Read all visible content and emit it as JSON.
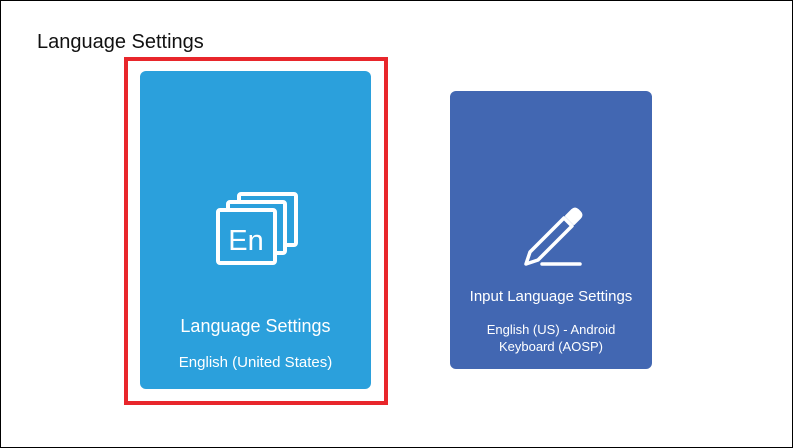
{
  "page": {
    "title": "Language Settings"
  },
  "cards": {
    "language": {
      "label": "Language Settings",
      "value": "English (United States)",
      "icon": "language-en-icon",
      "color": "#2ba0dc",
      "focused": true,
      "icon_text": "En"
    },
    "input_language": {
      "label": "Input Language Settings",
      "value": "English (US) - Android Keyboard (AOSP)",
      "icon": "pencil-icon",
      "color": "#4267b2"
    }
  },
  "colors": {
    "focus_ring": "#e8262b",
    "background": "#ffffff"
  }
}
